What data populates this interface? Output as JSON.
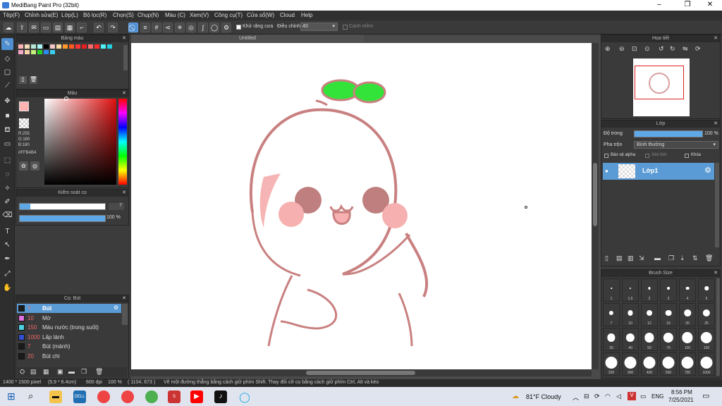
{
  "window": {
    "title": "MediBang Paint Pro (32bit)"
  },
  "menu": [
    "Tệp(F)",
    "Chỉnh sửa(E)",
    "Lớp(L)",
    "Bộ lọc(R)",
    "Chọn(S)",
    "Chụp(N)",
    "Màu (C)",
    "Xem(V)",
    "Công cụ(T)",
    "Cửa sổ(W)",
    "Cloud",
    "Help"
  ],
  "toolbar": {
    "antialias_label": "Khử răng cưa",
    "adjust_label": "Điều chỉnh",
    "adjust_value": "40",
    "smooth_label": "Canh mềm"
  },
  "palette_panel": {
    "title": "Bảng màu"
  },
  "color_panel": {
    "title": "Màu",
    "r": "R:255",
    "g": "G:180",
    "b": "B:180",
    "hex": "#FFB4B4"
  },
  "brush_control": {
    "title": "Kiểm soát cọ",
    "size": "7",
    "opacity": "100 %"
  },
  "brush_panel": {
    "title": "Cọ: Bút",
    "brushes": [
      {
        "size": "7",
        "name": "Bút",
        "color": "#1a1a1a"
      },
      {
        "size": "10",
        "name": "Mờ",
        "color": "#e070e0"
      },
      {
        "size": "150",
        "name": "Màu nước (trong suốt)",
        "color": "#4fd0e0"
      },
      {
        "size": "1000",
        "name": "Lấp lánh",
        "color": "#3050d0"
      },
      {
        "size": "7",
        "name": "Bút (mảnh)",
        "color": "#1a1a1a"
      },
      {
        "size": "20",
        "name": "Bút chì",
        "color": "#1a1a1a"
      }
    ]
  },
  "canvas": {
    "tab": "Untitled"
  },
  "navigator": {
    "title": "Họa tiết"
  },
  "layer_panel": {
    "title": "Lớp",
    "opacity_label": "Độ trong",
    "opacity_value": "100 %",
    "opacity_level": 1.0,
    "blend_label": "Pha trộn",
    "blend_value": "Bình thường",
    "protect_alpha": "Bảo vệ alpha",
    "clipping": "Xén bớt",
    "lock": "Khóa",
    "layer_name": "Lớp1"
  },
  "brush_size_panel": {
    "title": "Brush Size",
    "sizes": [
      "1",
      "1.5",
      "2",
      "3",
      "4",
      "5",
      "7",
      "10",
      "12",
      "15",
      "20",
      "25",
      "30",
      "40",
      "50",
      "70",
      "100",
      "150",
      "200",
      "300",
      "400",
      "500",
      "700",
      "1000"
    ]
  },
  "status": {
    "dims": "1400 * 1500 pixel",
    "physical": "(5.9 * 6.4cm)",
    "dpi": "600 dpi",
    "zoom": "100 %",
    "cursor": "( 1104, 673 )",
    "hint": "Vẽ một đường thẳng bằng cách giữ phím Shift. Thay đổi cỡ cọ bằng cách giữ phím Ctrl, Alt và kéo"
  },
  "taskbar": {
    "weather": "81°F Cloudy",
    "lang": "ENG",
    "time": "8:56 PM",
    "date": "7/25/2021"
  }
}
